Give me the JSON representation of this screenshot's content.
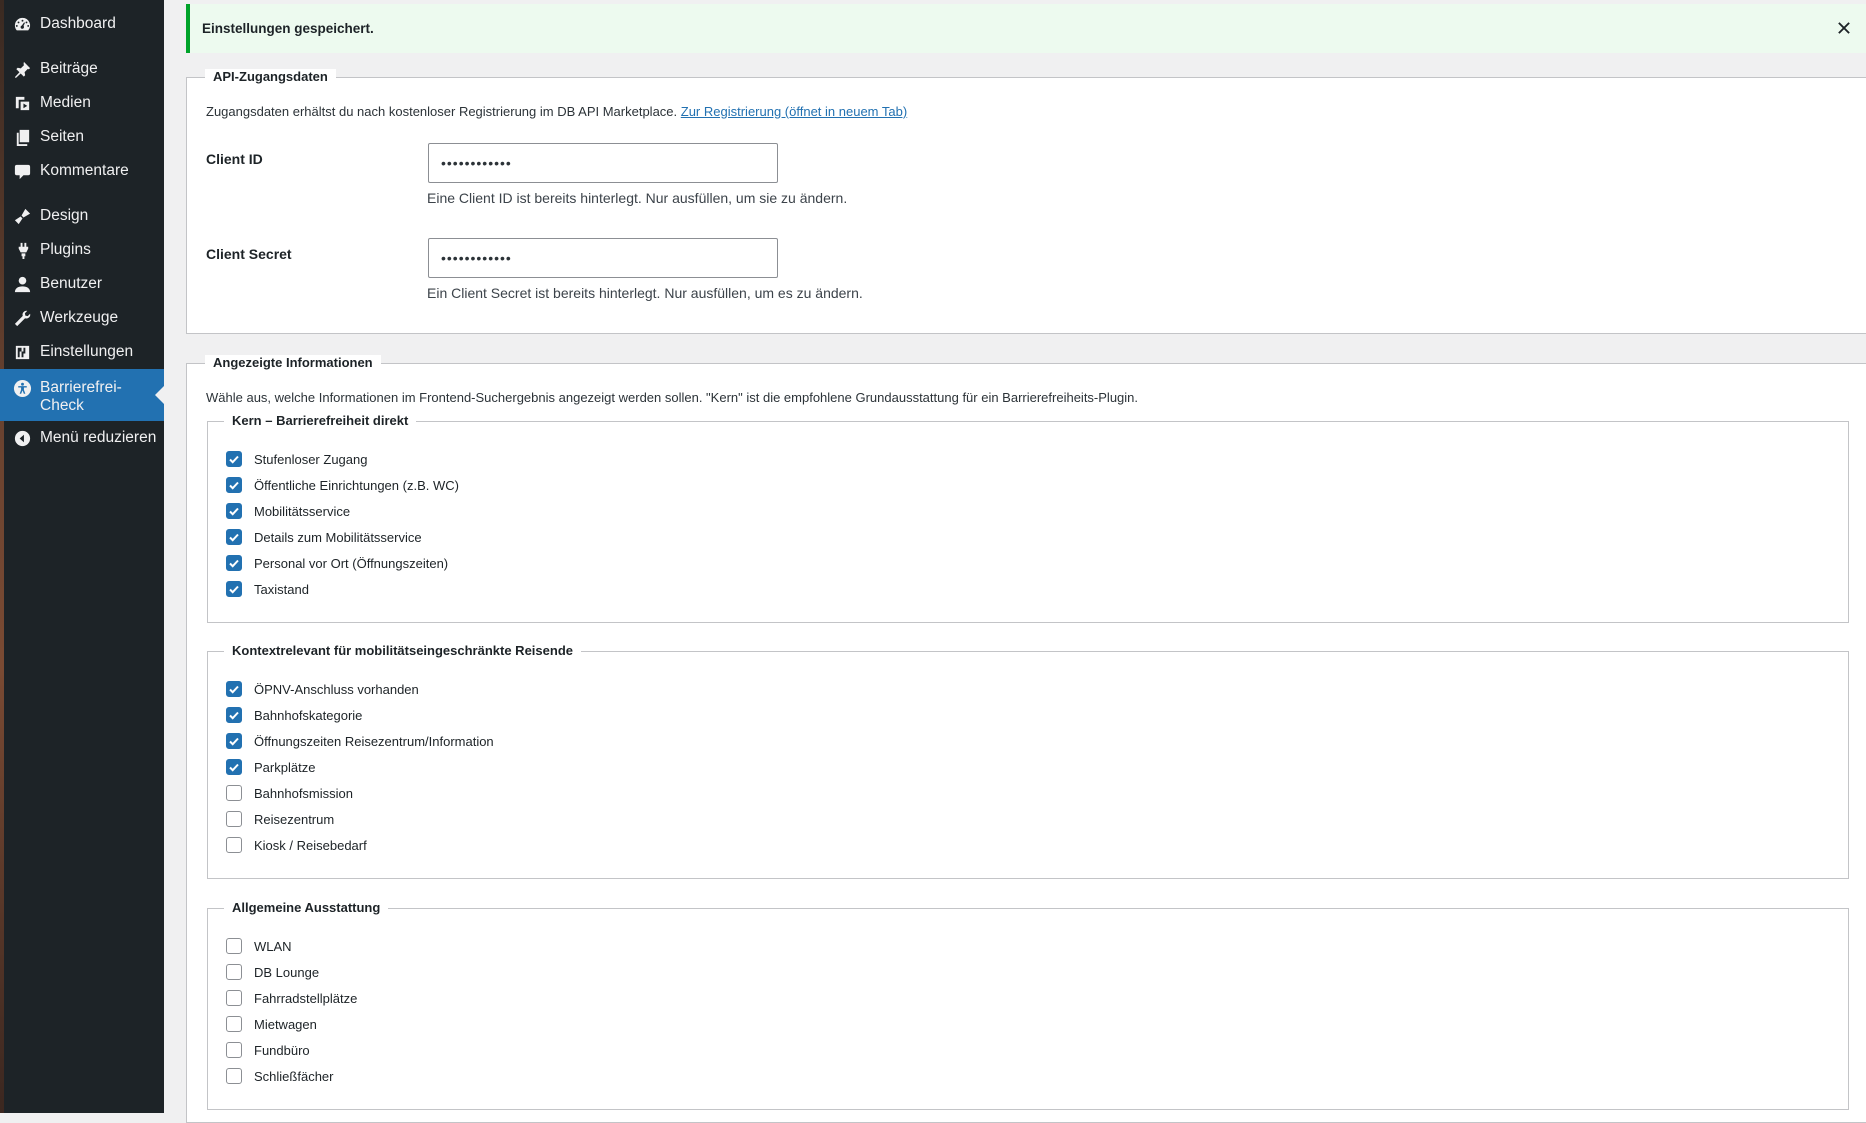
{
  "sidebar": {
    "items": [
      {
        "label": "Dashboard",
        "icon": "dashboard-icon"
      },
      {
        "label": "Beiträge",
        "icon": "pin-icon"
      },
      {
        "label": "Medien",
        "icon": "media-icon"
      },
      {
        "label": "Seiten",
        "icon": "pages-icon"
      },
      {
        "label": "Kommentare",
        "icon": "comment-icon"
      },
      {
        "label": "Design",
        "icon": "brush-icon"
      },
      {
        "label": "Plugins",
        "icon": "plugin-icon"
      },
      {
        "label": "Benutzer",
        "icon": "user-icon"
      },
      {
        "label": "Werkzeuge",
        "icon": "wrench-icon"
      },
      {
        "label": "Einstellungen",
        "icon": "settings-icon"
      },
      {
        "label": "Barrierefrei-Check",
        "icon": "accessibility-icon",
        "active": true
      },
      {
        "label": "Menü reduzieren",
        "icon": "collapse-icon"
      }
    ]
  },
  "notice": {
    "message": "Einstellungen gespeichert.",
    "close_icon": "close-icon"
  },
  "api": {
    "legend": "API-Zugangsdaten",
    "description": "Zugangsdaten erhältst du nach kostenloser Registrierung im DB API Marketplace.",
    "link_text": "Zur Registrierung (öffnet in neuem Tab)",
    "client_id_label": "Client ID",
    "client_id_value": "••••••••••••",
    "client_id_help": "Eine Client ID ist bereits hinterlegt. Nur ausfüllen, um sie zu ändern.",
    "client_secret_label": "Client Secret",
    "client_secret_value": "••••••••••••",
    "client_secret_help": "Ein Client Secret ist bereits hinterlegt. Nur ausfüllen, um es zu ändern."
  },
  "info": {
    "legend": "Angezeigte Informationen",
    "description": "Wähle aus, welche Informationen im Frontend-Suchergebnis angezeigt werden sollen. \"Kern\" ist die empfohlene Grundausstattung für ein Barrierefreiheits-Plugin.",
    "groups": [
      {
        "legend": "Kern – Barrierefreiheit direkt",
        "options": [
          {
            "label": "Stufenloser Zugang",
            "checked": true
          },
          {
            "label": "Öffentliche Einrichtungen (z.B. WC)",
            "checked": true
          },
          {
            "label": "Mobilitätsservice",
            "checked": true
          },
          {
            "label": "Details zum Mobilitätsservice",
            "checked": true
          },
          {
            "label": "Personal vor Ort (Öffnungszeiten)",
            "checked": true
          },
          {
            "label": "Taxistand",
            "checked": true
          }
        ]
      },
      {
        "legend": "Kontextrelevant für mobilitätseingeschränkte Reisende",
        "options": [
          {
            "label": "ÖPNV-Anschluss vorhanden",
            "checked": true
          },
          {
            "label": "Bahnhofskategorie",
            "checked": true
          },
          {
            "label": "Öffnungszeiten Reisezentrum/Information",
            "checked": true
          },
          {
            "label": "Parkplätze",
            "checked": true
          },
          {
            "label": "Bahnhofsmission",
            "checked": false
          },
          {
            "label": "Reisezentrum",
            "checked": false
          },
          {
            "label": "Kiosk / Reisebedarf",
            "checked": false
          }
        ]
      },
      {
        "legend": "Allgemeine Ausstattung",
        "options": [
          {
            "label": "WLAN",
            "checked": false
          },
          {
            "label": "DB Lounge",
            "checked": false
          },
          {
            "label": "Fahrradstellplätze",
            "checked": false
          },
          {
            "label": "Mietwagen",
            "checked": false
          },
          {
            "label": "Fundbüro",
            "checked": false
          },
          {
            "label": "Schließfächer",
            "checked": false
          }
        ]
      }
    ]
  },
  "colors": {
    "sidebar_bg": "#1d2327",
    "active_bg": "#2271b1",
    "notice_bg": "#edfaef",
    "notice_border": "#00a32a",
    "checkbox_checked": "#2271b1",
    "link": "#2271b1"
  }
}
